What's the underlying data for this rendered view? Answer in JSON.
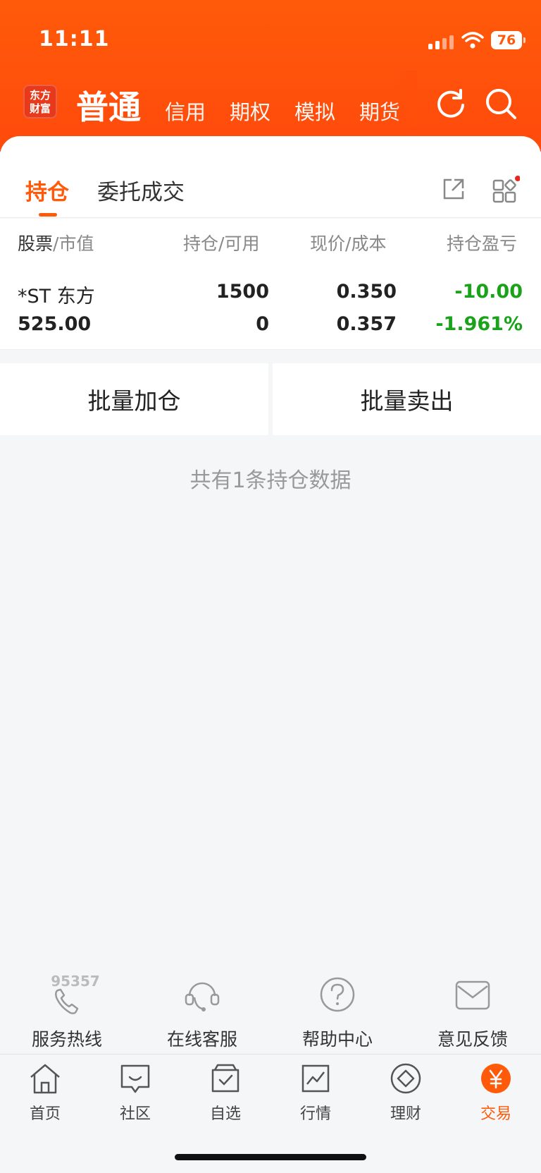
{
  "status": {
    "time": "11:11",
    "battery": "76"
  },
  "brand": {
    "logo": "东方\n财富"
  },
  "top_tabs": [
    {
      "label": "普通",
      "active": true
    },
    {
      "label": "信用"
    },
    {
      "label": "期权"
    },
    {
      "label": "模拟"
    },
    {
      "label": "期货"
    }
  ],
  "sub_tabs": [
    {
      "label": "持仓",
      "active": true
    },
    {
      "label": "委托成交"
    }
  ],
  "table": {
    "headers": [
      {
        "main": "股票",
        "sub": "市值"
      },
      {
        "main": "持仓",
        "sub": "可用"
      },
      {
        "main": "现价",
        "sub": "成本"
      },
      {
        "main": "持仓盈亏",
        "sub": ""
      }
    ],
    "rows": [
      {
        "name": "*ST 东方",
        "market_value": "525.00",
        "position": "1500",
        "available": "0",
        "price": "0.350",
        "cost": "0.357",
        "pnl": "-10.00",
        "pnl_pct": "-1.961%"
      }
    ]
  },
  "actions": {
    "batch_add": "批量加仓",
    "batch_sell": "批量卖出"
  },
  "summary": "共有1条持仓数据",
  "services": [
    {
      "label": "服务热线",
      "extra": "95357",
      "icon": "phone-icon"
    },
    {
      "label": "在线客服",
      "icon": "headset-icon"
    },
    {
      "label": "帮助中心",
      "icon": "question-icon"
    },
    {
      "label": "意见反馈",
      "icon": "mail-icon"
    }
  ],
  "bottom_nav": [
    {
      "label": "首页",
      "icon": "home-icon"
    },
    {
      "label": "社区",
      "icon": "chat-icon"
    },
    {
      "label": "自选",
      "icon": "watchlist-icon"
    },
    {
      "label": "行情",
      "icon": "chart-icon"
    },
    {
      "label": "理财",
      "icon": "diamond-icon"
    },
    {
      "label": "交易",
      "icon": "yen-icon",
      "active": true
    }
  ],
  "colors": {
    "brand": "#ff5a0a",
    "loss": "#1aa31a"
  }
}
